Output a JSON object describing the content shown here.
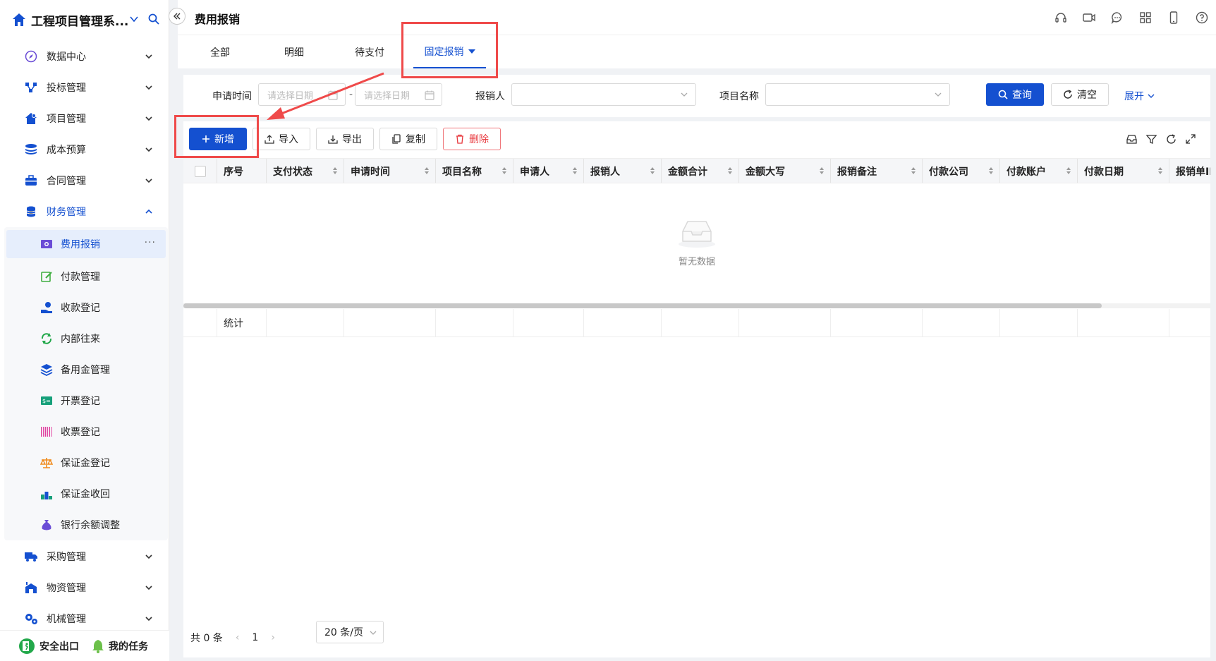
{
  "app": {
    "title": "工程项目管理系..."
  },
  "sidebar": {
    "menu_top": [
      {
        "label": "数据中心",
        "icon": "compass-icon"
      },
      {
        "label": "投标管理",
        "icon": "flow-icon"
      },
      {
        "label": "项目管理",
        "icon": "house-gear-icon"
      },
      {
        "label": "成本预算",
        "icon": "stack-icon"
      },
      {
        "label": "合同管理",
        "icon": "briefcase-icon"
      },
      {
        "label": "财务管理",
        "icon": "coins-icon"
      }
    ],
    "submenu": [
      {
        "label": "费用报销",
        "icon": "cash-icon",
        "more": "···"
      },
      {
        "label": "付款管理",
        "icon": "edit-icon"
      },
      {
        "label": "收款登记",
        "icon": "hand-coin-icon"
      },
      {
        "label": "内部往来",
        "icon": "refresh-icon"
      },
      {
        "label": "备用金管理",
        "icon": "layers-icon"
      },
      {
        "label": "开票登记",
        "icon": "dollar-card-icon"
      },
      {
        "label": "收票登记",
        "icon": "barcode-icon"
      },
      {
        "label": "保证金登记",
        "icon": "scale-icon"
      },
      {
        "label": "保证金收回",
        "icon": "podium-icon"
      },
      {
        "label": "银行余额调整",
        "icon": "money-bag-icon"
      }
    ],
    "menu_bottom": [
      {
        "label": "采购管理",
        "icon": "truck-icon"
      },
      {
        "label": "物资管理",
        "icon": "warehouse-icon"
      },
      {
        "label": "机械管理",
        "icon": "gears-icon"
      }
    ],
    "footer": {
      "exit": "安全出口",
      "tasks": "我的任务"
    }
  },
  "page": {
    "title": "费用报销"
  },
  "tabs": [
    {
      "label": "全部"
    },
    {
      "label": "明细"
    },
    {
      "label": "待支付"
    },
    {
      "label": "固定报销"
    }
  ],
  "filter": {
    "apply_time_label": "申请时间",
    "start_placeholder": "请选择日期",
    "end_placeholder": "请选择日期",
    "dash": "-",
    "reimburser_label": "报销人",
    "project_label": "项目名称",
    "query": "查询",
    "clear": "清空",
    "expand": "展开"
  },
  "toolbar": {
    "add": "新增",
    "import": "导入",
    "export": "导出",
    "copy": "复制",
    "delete": "删除"
  },
  "table": {
    "columns": [
      "序号",
      "支付状态",
      "申请时间",
      "项目名称",
      "申请人",
      "报销人",
      "金额合计",
      "金额大写",
      "报销备注",
      "付款公司",
      "付款账户",
      "付款日期",
      "报销单ID"
    ],
    "empty_text": "暂无数据",
    "summary_label": "统计"
  },
  "pagination": {
    "total": "共 0 条",
    "prev": "‹",
    "current": "1",
    "next": "›",
    "page_size": "20 条/页"
  },
  "colors": {
    "primary": "#1450d0",
    "danger": "#e8383d",
    "annotation": "#ef4a4a"
  }
}
